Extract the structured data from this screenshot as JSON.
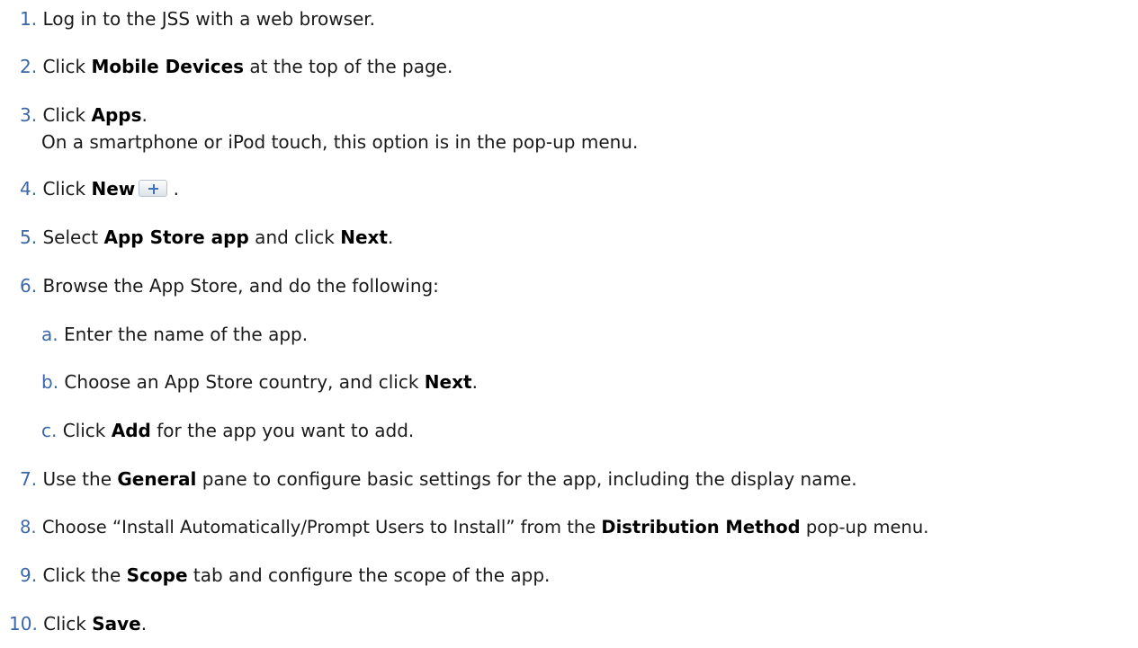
{
  "steps": [
    {
      "num": "1.",
      "parts": [
        "Log in to the JSS with a web browser."
      ]
    },
    {
      "num": "2.",
      "pre": "Click ",
      "bold": "Mobile Devices",
      "post": " at the top of the page."
    },
    {
      "num": "3.",
      "pre": "Click ",
      "bold": "Apps",
      "post": ".",
      "note": "On a smartphone or iPod touch, this option is in the pop-up menu."
    },
    {
      "num": "4.",
      "pre": "Click ",
      "bold": "New",
      "post": " ."
    },
    {
      "num": "5.",
      "pre": "Select ",
      "bold": "App Store app",
      "mid": " and click ",
      "bold2": "Next",
      "post": "."
    },
    {
      "num": "6.",
      "text": "Browse the App Store, and do the following:",
      "substeps": [
        {
          "num": "a.",
          "text": "Enter the name of the app."
        },
        {
          "num": "b.",
          "pre": "Choose an App Store country, and click ",
          "bold": "Next",
          "post": "."
        },
        {
          "num": "c.",
          "pre": "Click ",
          "bold": "Add",
          "post": " for the app you want to add."
        }
      ]
    },
    {
      "num": "7.",
      "pre": "Use the ",
      "bold": "General",
      "post": " pane to configure basic settings for the app, including the display name."
    },
    {
      "num": "8.",
      "pre": "Choose “Install Automatically/Prompt Users to Install” from the ",
      "bold": "Distribution Method",
      "post": " pop-up menu."
    },
    {
      "num": "9.",
      "pre": "Click the ",
      "bold": "Scope",
      "post": " tab and configure the scope of the app."
    },
    {
      "num": "10.",
      "pre": "Click ",
      "bold": "Save",
      "post": "."
    }
  ],
  "icons": {
    "new_button_icon": "plus-icon"
  }
}
